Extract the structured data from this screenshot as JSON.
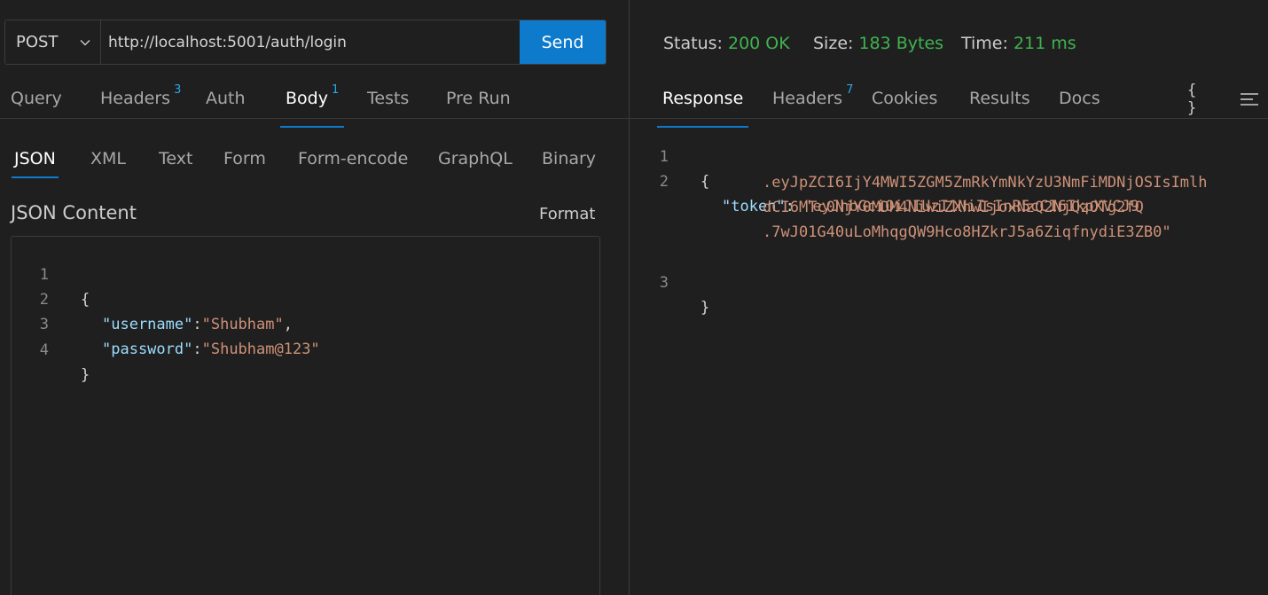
{
  "request": {
    "method": "POST",
    "url": "http://localhost:5001/auth/login",
    "send_label": "Send"
  },
  "request_tabs": [
    {
      "label": "Query",
      "badge": ""
    },
    {
      "label": "Headers",
      "badge": "3"
    },
    {
      "label": "Auth",
      "badge": ""
    },
    {
      "label": "Body",
      "badge": "1",
      "active": true
    },
    {
      "label": "Tests",
      "badge": ""
    },
    {
      "label": "Pre Run",
      "badge": ""
    }
  ],
  "body_tabs": [
    {
      "label": "JSON",
      "active": true
    },
    {
      "label": "XML"
    },
    {
      "label": "Text"
    },
    {
      "label": "Form"
    },
    {
      "label": "Form-encode"
    },
    {
      "label": "GraphQL"
    },
    {
      "label": "Binary"
    }
  ],
  "body_editor": {
    "title": "JSON Content",
    "format_label": "Format",
    "lines": [
      {
        "n": "1",
        "open": "{"
      },
      {
        "n": "2",
        "key": "\"username\"",
        "sep": ":",
        "value": "\"Shubham\"",
        "end": ","
      },
      {
        "n": "3",
        "key": "\"password\"",
        "sep": ":",
        "value": "\"Shubham@123\"",
        "end": ""
      },
      {
        "n": "4",
        "close": "}"
      }
    ]
  },
  "response_status": {
    "status_label": "Status:",
    "status_value": "200 OK",
    "size_label": "Size:",
    "size_value": "183 Bytes",
    "time_label": "Time:",
    "time_value": "211 ms"
  },
  "response_tabs": [
    {
      "label": "Response",
      "badge": "",
      "active": true
    },
    {
      "label": "Headers",
      "badge": "7"
    },
    {
      "label": "Cookies",
      "badge": ""
    },
    {
      "label": "Results",
      "badge": ""
    },
    {
      "label": "Docs",
      "badge": ""
    }
  ],
  "response_icons": {
    "braces": "{ }",
    "menu_icon": "menu-lines-icon"
  },
  "response_body": {
    "ln1": "1",
    "open": "{",
    "ln2": "2",
    "key": "\"token\"",
    "sep": ": ",
    "token_lines": [
      "\"eyJhbGciOiJIUzI1NiIsInR5cCI6IkpXVCJ9",
      ".eyJpZCI6IjY4MWI5ZGM5ZmRkYmNkYzU3NmFiMDNjOSIsImlh",
      "dCI6MTc0NjY0MDM4NiwiZXhwIjoxNzQ2NjQzOTg2fQ",
      ".7wJ01G40uLoMhqgQW9Hco8HZkrJ5a6ZiqfnydiE3ZB0\""
    ],
    "ln3": "3",
    "close": "}"
  },
  "colors": {
    "accent": "#0e7acc",
    "status_ok": "#3fb34f",
    "badge": "#2aa7ea",
    "json_key": "#9cdcfe",
    "json_string": "#ce9178"
  }
}
